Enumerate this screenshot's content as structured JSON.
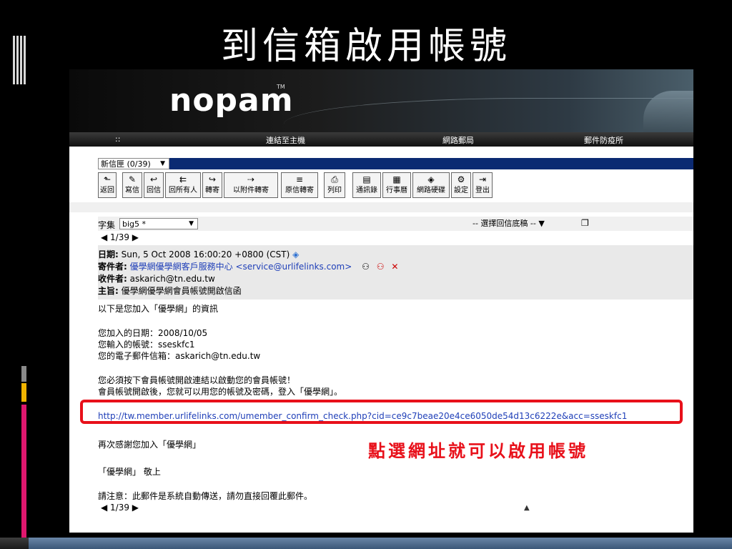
{
  "slide": {
    "title": "到信箱啟用帳號"
  },
  "banner": {
    "logo": "nopam",
    "tm": "TM"
  },
  "nav": {
    "left": "::",
    "items": [
      "連結至主機",
      "網路郵局",
      "郵件防疫所"
    ]
  },
  "folder": {
    "selected": "新信匣 (0/39)",
    "arrow": "▼"
  },
  "toolbar": [
    {
      "icon": "back-icon",
      "glyph": "⬑",
      "label": "返回"
    },
    {
      "icon": "compose-icon",
      "glyph": "✎",
      "label": "寫信"
    },
    {
      "icon": "reply-icon",
      "glyph": "↩",
      "label": "回信"
    },
    {
      "icon": "reply-all-icon",
      "glyph": "⇇",
      "label": "回所有人"
    },
    {
      "icon": "forward-icon",
      "glyph": "↪",
      "label": "轉寄"
    },
    {
      "icon": "forward-attach-icon",
      "glyph": "⇢",
      "label": "以附件轉寄"
    },
    {
      "icon": "forward-original-icon",
      "glyph": "≡",
      "label": "原信轉寄"
    },
    {
      "icon": "print-icon",
      "glyph": "⎙",
      "label": "列印"
    },
    {
      "icon": "addressbook-icon",
      "glyph": "▤",
      "label": "通訊錄"
    },
    {
      "icon": "calendar-icon",
      "glyph": "▦",
      "label": "行事曆"
    },
    {
      "icon": "netdisk-icon",
      "glyph": "◈",
      "label": "網路硬碟"
    },
    {
      "icon": "settings-icon",
      "glyph": "⚙",
      "label": "設定"
    },
    {
      "icon": "logout-icon",
      "glyph": "⇥",
      "label": "登出"
    }
  ],
  "charset": {
    "label": "字集",
    "selected": "big5 *",
    "arrow": "▼"
  },
  "reply_template": {
    "selected": "-- 選擇回信底稿 --",
    "arrow": "▼"
  },
  "pager": "◀ 1/39 ▶",
  "headers": {
    "date_label": "日期:",
    "date": "Sun, 5 Oct 2008 16:00:20 +0800 (CST)",
    "from_label": "寄件者:",
    "from": "優學網優學網客戶服務中心 <service@urlifelinks.com>",
    "to_label": "收件者:",
    "to": "askarich@tn.edu.tw",
    "subject_label": "主旨:",
    "subject": "優學網優學網會員帳號開啟信函"
  },
  "body": {
    "intro": "以下是您加入「優學網」的資訊",
    "joined": "您加入的日期：2008/10/05",
    "account": "您輸入的帳號：sseskfc1",
    "email": "您的電子郵件信箱：askarich@tn.edu.tw",
    "instruction1": "您必須按下會員帳號開啟連結以啟動您的會員帳號！",
    "instruction2": "會員帳號開啟後，您就可以用您的帳號及密碼，登入「優學網」。",
    "link": "http://tw.member.urlifelinks.com/umember_confirm_check.php?cid=ce9c7beae20e4ce6050de54d13c6222e&acc=sseskfc1",
    "thanks": "再次感謝您加入「優學網」",
    "sign": "「優學網」 敬上",
    "notice": "請注意：此郵件是系統自動傳送，請勿直接回覆此郵件。"
  },
  "annotation": "點選網址就可以啟用帳號",
  "colors": {
    "highlight": "#e8101a",
    "link": "#1f3fb8",
    "folderbar": "#0b2a72"
  }
}
